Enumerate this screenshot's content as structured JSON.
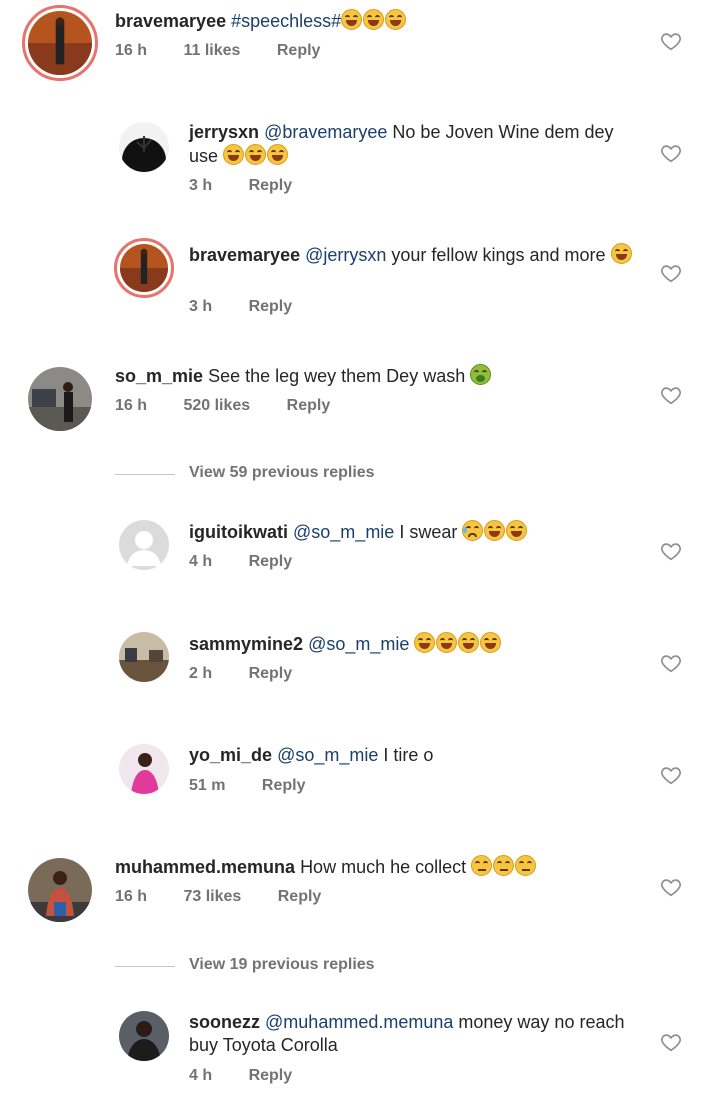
{
  "comments": [
    {
      "id": "c1",
      "username": "bravemaryee",
      "text": "#speechless#",
      "emoji": [
        "laugh",
        "laugh",
        "laugh"
      ],
      "time": "16 h",
      "likes": "11 likes",
      "reply": "Reply"
    },
    {
      "id": "r1",
      "username": "jerrysxn",
      "mention": "@bravemaryee",
      "text": "No be Joven Wine dem dey use",
      "emoji": [
        "laugh",
        "laugh",
        "laugh"
      ],
      "time": "3 h",
      "reply": "Reply"
    },
    {
      "id": "r2",
      "username": "bravemaryee",
      "mention": "@jerrysxn",
      "text": "your fellow kings and more",
      "emoji": [
        "laugh"
      ],
      "time": "3 h",
      "reply": "Reply"
    },
    {
      "id": "c2",
      "username": "so_m_mie",
      "text": "See the leg wey them Dey wash",
      "emoji": [
        "sick"
      ],
      "time": "16 h",
      "likes": "520 likes",
      "reply": "Reply"
    },
    {
      "id": "r3",
      "username": "iguitoikwati",
      "mention": "@so_m_mie",
      "text": "I swear",
      "emoji": [
        "cry",
        "laugh",
        "laugh"
      ],
      "time": "4 h",
      "reply": "Reply"
    },
    {
      "id": "r4",
      "username": "sammymine2",
      "mention": "@so_m_mie",
      "text": "",
      "emoji": [
        "laugh",
        "laugh",
        "laugh",
        "laugh"
      ],
      "time": "2 h",
      "reply": "Reply"
    },
    {
      "id": "r5",
      "username": "yo_mi_de",
      "mention": "@so_m_mie",
      "text": "I tire o",
      "emoji": [],
      "time": "51 m",
      "reply": "Reply"
    },
    {
      "id": "c3",
      "username": "muhammed.memuna",
      "text": "How much he collect",
      "emoji": [
        "unamused",
        "unamused",
        "unamused"
      ],
      "time": "16 h",
      "likes": "73 likes",
      "reply": "Reply"
    },
    {
      "id": "r6",
      "username": "soonezz",
      "mention": "@muhammed.memuna",
      "text": "money way no reach buy Toyota Corolla",
      "emoji": [],
      "time": "4 h",
      "reply": "Reply"
    }
  ],
  "view_previous": [
    {
      "label": "View 59 previous replies"
    },
    {
      "label": "View 19 previous replies"
    }
  ],
  "colors": {
    "mention": "#1a3f6e",
    "meta": "#737373",
    "text": "#262626",
    "story_ring": "#e8726c"
  }
}
